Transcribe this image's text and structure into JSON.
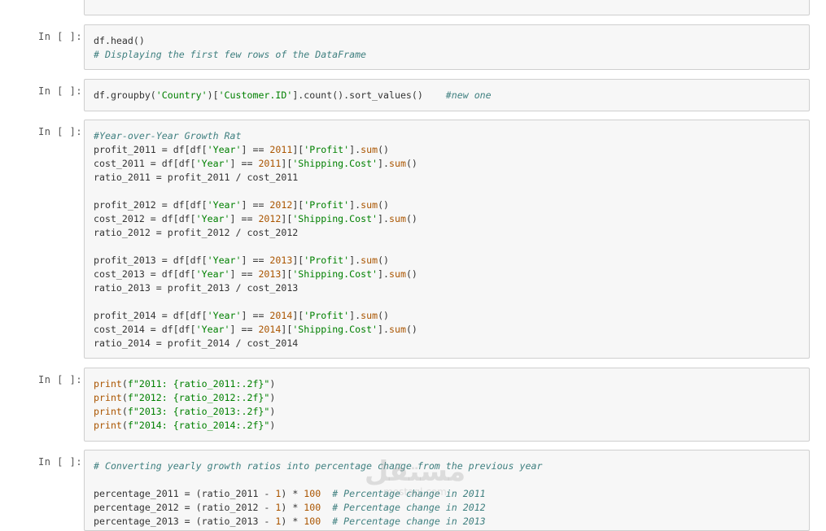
{
  "cells": [
    {
      "prompt": "",
      "lines": []
    },
    {
      "prompt": "In [ ]:",
      "lines": [
        "df.head()",
        "# Displaying the first few rows of the DataFrame"
      ]
    },
    {
      "prompt": "In [ ]:",
      "lines": [
        "df.groupby('Country')['Customer.ID'].count().sort_values()    #new one"
      ]
    },
    {
      "prompt": "In [ ]:",
      "lines": [
        "#Year-over-Year Growth Rat",
        "profit_2011 = df[df['Year'] == 2011]['Profit'].sum()",
        "cost_2011 = df[df['Year'] == 2011]['Shipping.Cost'].sum()",
        "ratio_2011 = profit_2011 / cost_2011",
        "",
        "profit_2012 = df[df['Year'] == 2012]['Profit'].sum()",
        "cost_2012 = df[df['Year'] == 2012]['Shipping.Cost'].sum()",
        "ratio_2012 = profit_2012 / cost_2012",
        "",
        "profit_2013 = df[df['Year'] == 2013]['Profit'].sum()",
        "cost_2013 = df[df['Year'] == 2013]['Shipping.Cost'].sum()",
        "ratio_2013 = profit_2013 / cost_2013",
        "",
        "profit_2014 = df[df['Year'] == 2014]['Profit'].sum()",
        "cost_2014 = df[df['Year'] == 2014]['Shipping.Cost'].sum()",
        "ratio_2014 = profit_2014 / cost_2014"
      ]
    },
    {
      "prompt": "In [ ]:",
      "lines": [
        "print(f\"2011: {ratio_2011:.2f}\")",
        "print(f\"2012: {ratio_2012:.2f}\")",
        "print(f\"2013: {ratio_2013:.2f}\")",
        "print(f\"2014: {ratio_2014:.2f}\")"
      ]
    },
    {
      "prompt": "In [ ]:",
      "lines": [
        "# Converting yearly growth ratios into percentage change from the previous year",
        "",
        "percentage_2011 = (ratio_2011 - 1) * 100  # Percentage change in 2011",
        "percentage_2012 = (ratio_2012 - 1) * 100  # Percentage change in 2012",
        "percentage_2013 = (ratio_2013 - 1) * 100  # Percentage change in 2013"
      ]
    }
  ],
  "watermark": {
    "text": "مستقل",
    "sub": "mostaql.com"
  }
}
